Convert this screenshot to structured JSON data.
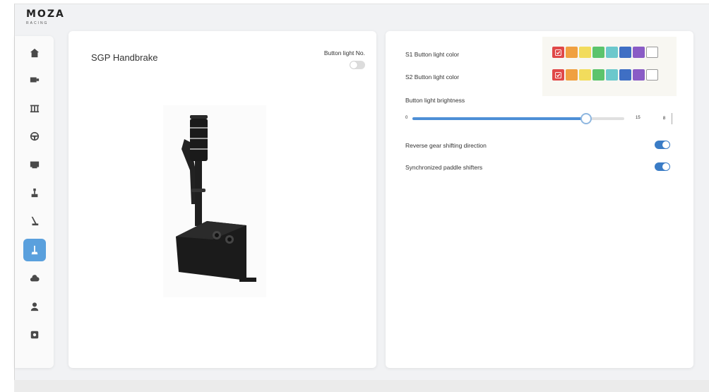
{
  "app": {
    "logo": "MOZA",
    "logo_sub": "RACING"
  },
  "sidebar": {
    "items": [
      {
        "name": "home",
        "icon": "home-icon",
        "active": false
      },
      {
        "name": "wheelbase",
        "icon": "wheelbase-icon",
        "active": false
      },
      {
        "name": "pedals",
        "icon": "pedals-icon",
        "active": false
      },
      {
        "name": "steering-wheel",
        "icon": "steering-wheel-icon",
        "active": false
      },
      {
        "name": "dashboard",
        "icon": "dashboard-icon",
        "active": false
      },
      {
        "name": "shifter",
        "icon": "shifter-icon",
        "active": false
      },
      {
        "name": "handbrake",
        "icon": "handbrake-icon",
        "active": false
      },
      {
        "name": "sequential-shifter",
        "icon": "sequential-shifter-icon",
        "active": true
      },
      {
        "name": "cloud",
        "icon": "cloud-icon",
        "active": false
      },
      {
        "name": "profile",
        "icon": "profile-icon",
        "active": false
      },
      {
        "name": "settings",
        "icon": "settings-icon",
        "active": false
      }
    ]
  },
  "product": {
    "title": "SGP Handbrake",
    "button_light_label": "Button light No.",
    "button_light_on": false
  },
  "settings": {
    "s1_label": "S1 Button light color",
    "s2_label": "S2 Button light color",
    "brightness_label": "Button light brightness",
    "brightness_min": "0",
    "brightness_max": "15",
    "brightness_value": "8",
    "brightness_fraction": 0.82,
    "reverse_label": "Reverse gear shifting direction",
    "reverse_on": true,
    "sync_label": "Synchronized paddle shifters",
    "sync_on": true
  },
  "palette": [
    "#e04848",
    "#f0a040",
    "#f2dc5c",
    "#5cc46c",
    "#6cc8cc",
    "#3f6fc4",
    "#8a5cc6",
    "#ffffff"
  ],
  "s1_selected_index": 0,
  "s2_selected_index": 0
}
